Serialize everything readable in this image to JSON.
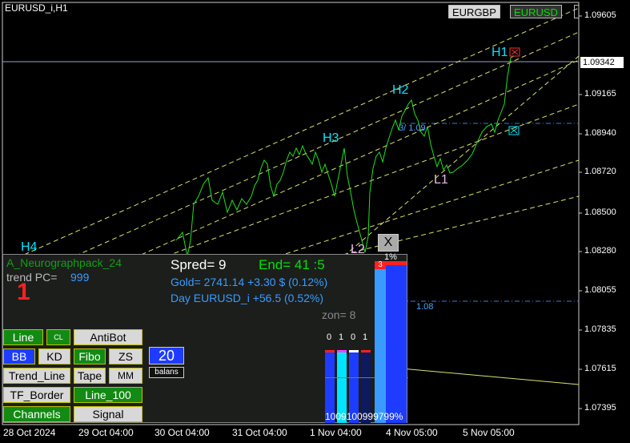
{
  "window": {
    "title": "EURUSD_i,H1"
  },
  "symbol_buttons": {
    "eurgbp": "EURGBP",
    "eurusd": "EURUSD"
  },
  "price_axis": {
    "labels": [
      "1.09605",
      "1.09165",
      "1.08940",
      "1.08720",
      "1.08500",
      "1.08280",
      "1.08055",
      "1.07835",
      "1.07615",
      "1.07395"
    ],
    "current": "1.09342"
  },
  "time_axis": {
    "labels": [
      "28 Oct 2024",
      "29 Oct 04:00",
      "30 Oct 04:00",
      "31 Oct 04:00",
      "1 Nov 04:00",
      "4 Nov 05:00",
      "5 Nov 05:00"
    ]
  },
  "chart_labels": {
    "h1": "H1",
    "h2": "H2",
    "h3": "H3",
    "h4": "H4",
    "l1": "L1",
    "l2": "L2",
    "level_a": "3/ 1.09",
    "level_b": "1.08"
  },
  "panel": {
    "name": "A_Neurographpack_24",
    "trend_label": "trend PC=",
    "trend_value": "999",
    "signal_number": "1",
    "spread": "Spred= 9",
    "end": "End= 41 :5",
    "gold": "Gold= 2741.14 +3.30 $ (0.12%)",
    "day": "Day EURUSD_i   +56.5 (0.52%)",
    "zone": "zon= 8",
    "close": "X",
    "buttons": {
      "line": "Line",
      "cl": "CL",
      "antibot": "AntiBot",
      "bb": "BB",
      "kd": "KD",
      "fibo": "Fibo",
      "zs": "ZS",
      "trend_line": "Trend_Line",
      "tape": "Tape",
      "mm": "MM",
      "tf_border": "TF_Border",
      "line_100": "Line_100",
      "channels": "Channels",
      "signal": "Signal"
    },
    "counter": {
      "value": "20",
      "label": "balans"
    },
    "bars": {
      "top_values": [
        "0",
        "1",
        "0",
        "1"
      ],
      "big_top_pct": "1%",
      "big_marker": "3",
      "bottom_text": "1009100999799%"
    }
  },
  "colors": {
    "accent_green": "#00ff00",
    "cyan": "#00e5ff",
    "dashed_line": "#d9e36a",
    "level_blue": "#4aa3ff",
    "panel_blue": "#3a9bff",
    "red": "#ff2020"
  }
}
